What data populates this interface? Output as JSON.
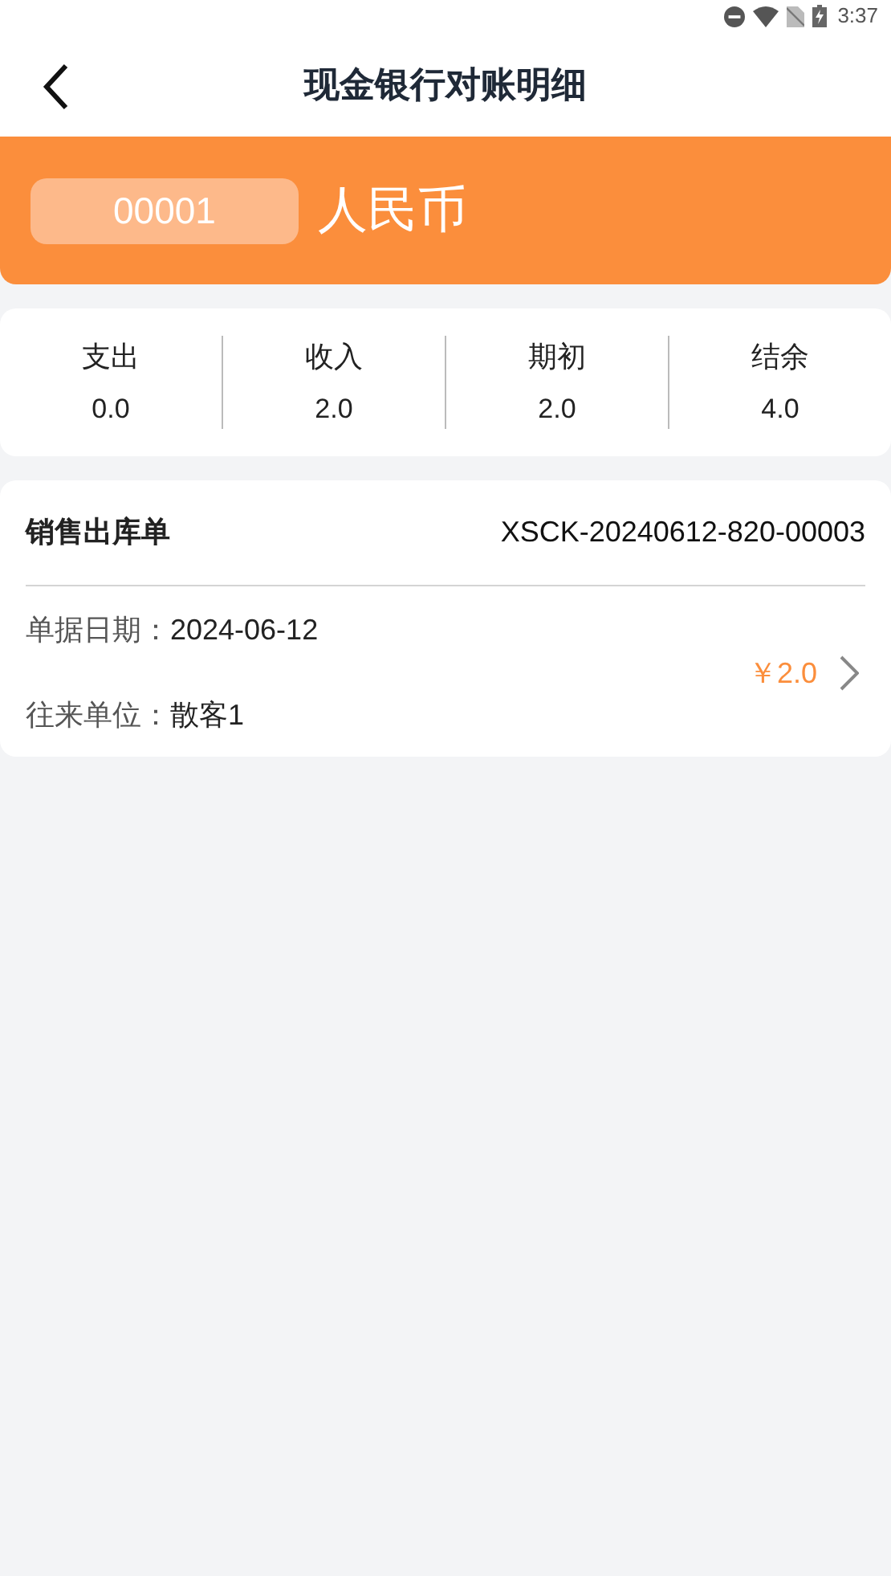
{
  "status_bar": {
    "time": "3:37"
  },
  "header": {
    "title": "现金银行对账明细"
  },
  "account": {
    "code": "00001",
    "currency": "人民币"
  },
  "summary": [
    {
      "label": "支出",
      "value": "0.0"
    },
    {
      "label": "收入",
      "value": "2.0"
    },
    {
      "label": "期初",
      "value": "2.0"
    },
    {
      "label": "结余",
      "value": "4.0"
    }
  ],
  "records": [
    {
      "type": "销售出库单",
      "number": "XSCK-20240612-820-00003",
      "fields": [
        {
          "label": "单据日期：",
          "value": "2024-06-12"
        },
        {
          "label": "往来单位：",
          "value": "散客1"
        }
      ],
      "amount": "￥2.0"
    }
  ]
}
